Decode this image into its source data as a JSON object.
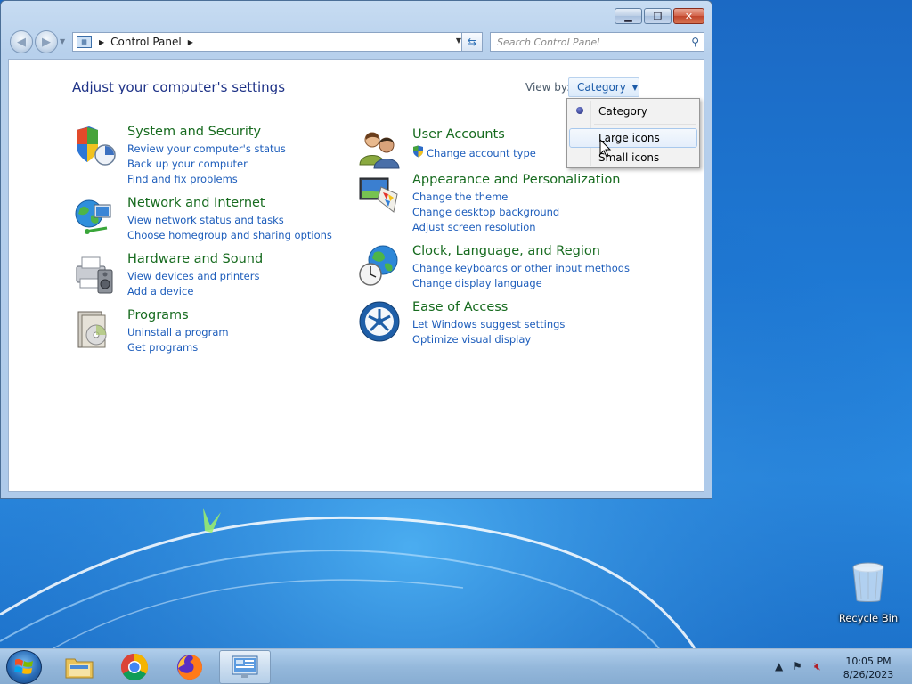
{
  "window": {
    "minimize": "▁",
    "maximize": "❐",
    "close": "✕"
  },
  "address": {
    "path": "Control Panel",
    "search_placeholder": "Search Control Panel"
  },
  "content": {
    "heading": "Adjust your computer's settings",
    "view_by_label": "View by:",
    "view_by_value": "Category"
  },
  "categories": [
    {
      "title": "System and Security",
      "links": [
        "Review your computer's status",
        "Back up your computer",
        "Find and fix problems"
      ]
    },
    {
      "title": "Network and Internet",
      "links": [
        "View network status and tasks",
        "Choose homegroup and sharing options"
      ]
    },
    {
      "title": "Hardware and Sound",
      "links": [
        "View devices and printers",
        "Add a device"
      ]
    },
    {
      "title": "Programs",
      "links": [
        "Uninstall a program",
        "Get programs"
      ]
    },
    {
      "title": "User Accounts",
      "links": [
        "Change account type"
      ]
    },
    {
      "title": "Appearance and Personalization",
      "links": [
        "Change the theme",
        "Change desktop background",
        "Adjust screen resolution"
      ]
    },
    {
      "title": "Clock, Language, and Region",
      "links": [
        "Change keyboards or other input methods",
        "Change display language"
      ]
    },
    {
      "title": "Ease of Access",
      "links": [
        "Let Windows suggest settings",
        "Optimize visual display"
      ]
    }
  ],
  "menu": {
    "items": [
      "Category",
      "Large icons",
      "Small icons"
    ],
    "selected": "Category",
    "hovered": "Large icons"
  },
  "desktop": {
    "recycle_bin": "Recycle Bin"
  },
  "taskbar": {
    "time": "10:05 PM",
    "date": "8/26/2023",
    "apps": [
      "windows-explorer",
      "chrome",
      "firefox",
      "control-panel"
    ]
  }
}
